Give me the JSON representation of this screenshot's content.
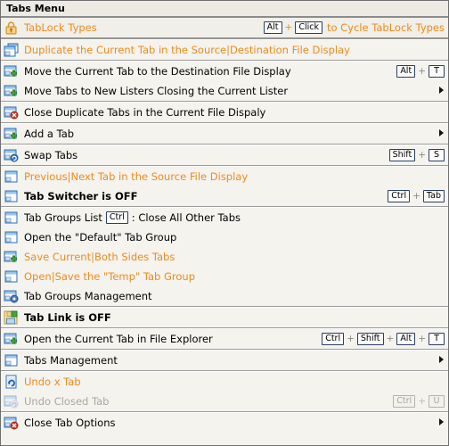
{
  "window": {
    "title": "Tabs Menu"
  },
  "colors": {
    "accent_orange": "#f08a1a",
    "key_border": "#2b3f63",
    "background": "#f4f3ee",
    "disabled": "#a8a7a2"
  },
  "keys": {
    "alt": "Alt",
    "click": "Click",
    "t": "T",
    "shift": "Shift",
    "s": "S",
    "ctrl": "Ctrl",
    "tab": "Tab",
    "u": "U",
    "plus": "+"
  },
  "items": [
    {
      "id": "tablock-types",
      "icon": "padlock-icon",
      "label": "TabLock Types",
      "trailing_text": "to Cycle TabLock Types",
      "keys": [
        "Alt",
        "Click"
      ],
      "style": "orange",
      "highlight": true,
      "submenu": false,
      "separator_after": true
    },
    {
      "id": "duplicate-current-tab",
      "icon": "duplicate-window-icon",
      "label": "Duplicate the Current Tab in the Source|Destination File Display",
      "keys": [],
      "style": "orange",
      "submenu": false,
      "separator_after": true
    },
    {
      "id": "move-current-tab-destination",
      "icon": "window-add-icon",
      "label": "Move the Current Tab to the Destination File Display",
      "keys": [
        "Alt",
        "T"
      ],
      "style": "normal",
      "submenu": false,
      "separator_after": false
    },
    {
      "id": "move-tabs-new-listers",
      "icon": "window-add-icon",
      "label": "Move Tabs to New Listers Closing the Current Lister",
      "keys": [],
      "style": "normal",
      "submenu": true,
      "separator_after": true
    },
    {
      "id": "close-duplicate-tabs",
      "icon": "window-close-icon",
      "label": "Close Duplicate Tabs in the Current File Dispaly",
      "keys": [],
      "style": "normal",
      "submenu": false,
      "separator_after": true
    },
    {
      "id": "add-a-tab",
      "icon": "window-add-icon",
      "label": "Add a Tab",
      "keys": [],
      "style": "normal",
      "submenu": true,
      "separator_after": true
    },
    {
      "id": "swap-tabs",
      "icon": "window-swap-icon",
      "label": "Swap Tabs",
      "keys": [
        "Shift",
        "S"
      ],
      "style": "normal",
      "submenu": false,
      "separator_after": true
    },
    {
      "id": "previous-next-tab",
      "icon": "window-icon",
      "label": "Previous|Next Tab in the Source File Display",
      "keys": [],
      "style": "orange",
      "submenu": false,
      "separator_after": false
    },
    {
      "id": "tab-switcher-toggle",
      "icon": "window-icon",
      "label": "Tab Switcher is OFF",
      "keys": [
        "Ctrl",
        "Tab"
      ],
      "style": "bold",
      "submenu": false,
      "separator_after": true
    },
    {
      "id": "tab-groups-list",
      "icon": "window-icon",
      "label_before": "Tab Groups List",
      "inline_key": "Ctrl",
      "label_after": ": Close All Other Tabs",
      "keys": [],
      "style": "normal",
      "submenu": false,
      "separator_after": false
    },
    {
      "id": "open-default-tab-group",
      "icon": "window-icon",
      "label": "Open the \"Default\" Tab Group",
      "keys": [],
      "style": "normal",
      "submenu": false,
      "separator_after": false
    },
    {
      "id": "save-current-both-sides-tabs",
      "icon": "window-add-icon",
      "label": "Save Current|Both Sides Tabs",
      "keys": [],
      "style": "orange",
      "submenu": false,
      "separator_after": false
    },
    {
      "id": "open-save-temp-tab-group",
      "icon": "window-icon",
      "label": "Open|Save the \"Temp\" Tab Group",
      "keys": [],
      "style": "orange",
      "submenu": false,
      "separator_after": false
    },
    {
      "id": "tab-groups-management",
      "icon": "window-gear-icon",
      "label": "Tab Groups Management",
      "keys": [],
      "style": "normal",
      "submenu": false,
      "separator_after": true
    },
    {
      "id": "tab-link-toggle",
      "icon": "tab-link-icon",
      "label": "Tab Link is OFF",
      "keys": [],
      "style": "bold",
      "submenu": false,
      "separator_after": true
    },
    {
      "id": "open-current-tab-file-explorer",
      "icon": "window-add-icon",
      "label": "Open the Current Tab in File Explorer",
      "keys": [
        "Ctrl",
        "Shift",
        "Alt",
        "T"
      ],
      "style": "normal",
      "submenu": false,
      "separator_after": true
    },
    {
      "id": "tabs-management",
      "icon": "window-icon",
      "label": "Tabs Management",
      "keys": [],
      "style": "normal",
      "submenu": true,
      "separator_after": true
    },
    {
      "id": "undo-x-tab",
      "icon": "undo-page-icon",
      "label": "Undo x Tab",
      "keys": [],
      "style": "orange",
      "submenu": false,
      "separator_after": false
    },
    {
      "id": "undo-closed-tab",
      "icon": "window-undo-icon",
      "label": "Undo Closed Tab",
      "keys": [
        "Ctrl",
        "U"
      ],
      "style": "disabled",
      "submenu": false,
      "separator_after": true
    },
    {
      "id": "close-tab-options",
      "icon": "window-close-icon",
      "label": "Close Tab Options",
      "keys": [],
      "style": "normal",
      "submenu": true,
      "separator_after": false
    }
  ]
}
